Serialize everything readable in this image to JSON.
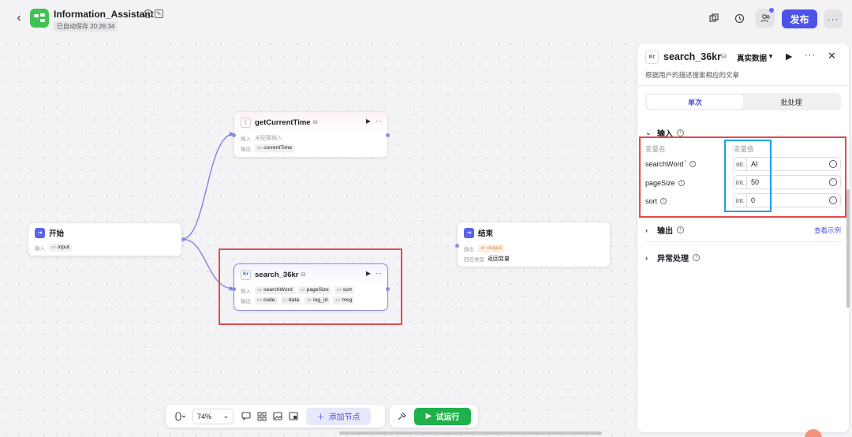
{
  "header": {
    "app_title": "Information_Assistant",
    "autosave": "已自动保存 20:26:34",
    "publish_label": "发布"
  },
  "nodes": {
    "start": {
      "title": "开始",
      "in_label": "输入",
      "in_type": "str",
      "in_var": "input"
    },
    "get_time": {
      "title": "getCurrentTime",
      "in_label": "输入",
      "in_value": "未配置输入",
      "out_label": "输出",
      "out_type": "str",
      "out_var": "currentTime"
    },
    "search": {
      "title": "search_36kr",
      "in_label": "输入",
      "out_label": "输出",
      "inputs": [
        {
          "type": "str",
          "name": "searchWord"
        },
        {
          "type": "int",
          "name": "pageSize"
        },
        {
          "type": "int",
          "name": "sort"
        }
      ],
      "outputs": [
        {
          "type": "int",
          "name": "code"
        },
        {
          "type": "{ }",
          "name": "data"
        },
        {
          "type": "str",
          "name": "log_id"
        },
        {
          "type": "str",
          "name": "msg"
        }
      ]
    },
    "end": {
      "title": "结束",
      "out_label": "输出",
      "out_type": "str",
      "out_var": "output",
      "type_label": "回答类型",
      "type_value": "返回变量"
    }
  },
  "toolbar": {
    "zoom": "74%",
    "add_node_label": "添加节点",
    "run_label": "试运行"
  },
  "panel": {
    "title": "search_36kr",
    "mode": "真实数据",
    "description": "根据用户的描述搜索相应的文章",
    "tabs": [
      "单次",
      "批处理"
    ],
    "input_section": "输入",
    "col_name": "变量名",
    "col_value": "变量值",
    "params": [
      {
        "name": "searchWord",
        "required": "*",
        "type": "str.",
        "value": "AI"
      },
      {
        "name": "pageSize",
        "required": "",
        "type": "int.",
        "value": "50"
      },
      {
        "name": "sort",
        "required": "",
        "type": "int.",
        "value": "0"
      }
    ],
    "output_section": "输出",
    "see_example": "查看示例",
    "error_section": "异常处理"
  },
  "colors": {
    "accent": "#4d53e8",
    "run": "#1fb14a",
    "highlight_red": "#e5484d",
    "highlight_blue": "#1f9ee0"
  }
}
